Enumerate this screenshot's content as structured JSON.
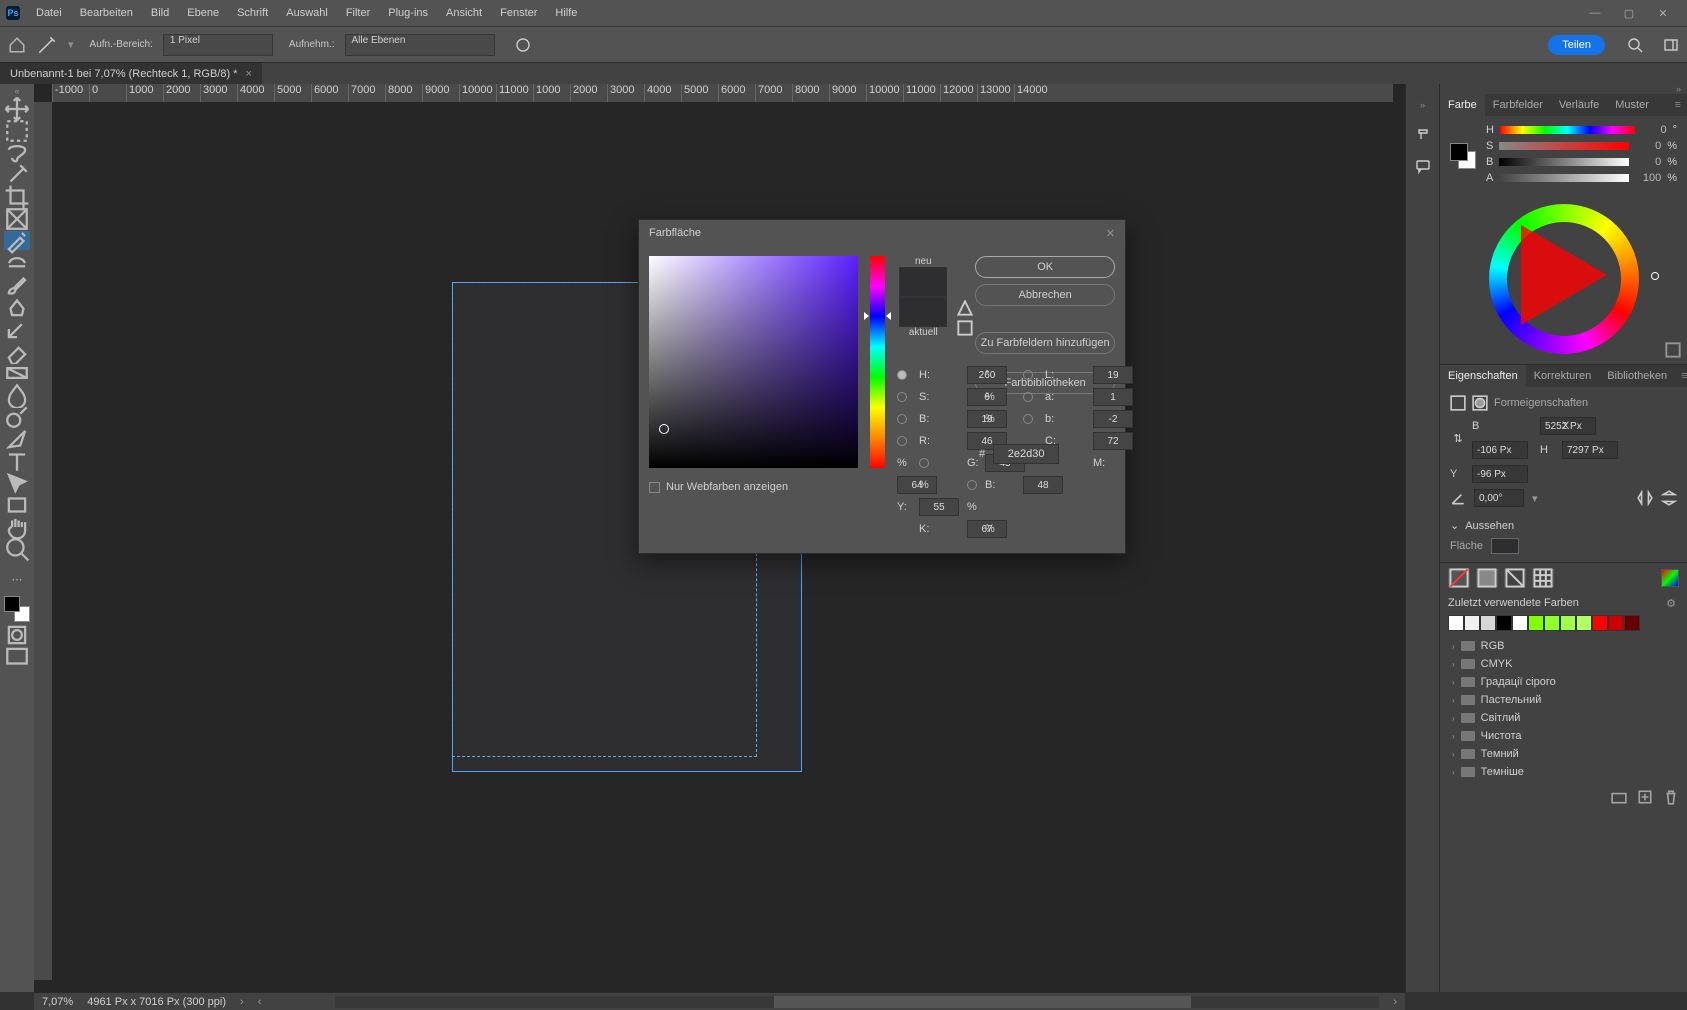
{
  "menubar": {
    "items": [
      "Datei",
      "Bearbeiten",
      "Bild",
      "Ebene",
      "Schrift",
      "Auswahl",
      "Filter",
      "Plug-ins",
      "Ansicht",
      "Fenster",
      "Hilfe"
    ]
  },
  "optbar": {
    "sample_label": "Aufn.-Bereich:",
    "sample_value": "1 Pixel",
    "sample2_label": "Aufnehm.:",
    "sample2_value": "Alle Ebenen",
    "share": "Teilen"
  },
  "tab": {
    "title": "Unbenannt-1 bei 7,07% (Rechteck 1, RGB/8) *"
  },
  "ruler_marks": [
    "-1000",
    "0",
    "1000",
    "2000",
    "3000",
    "4000",
    "5000",
    "6000",
    "7000",
    "8000",
    "9000",
    "10000",
    "11000",
    "1000",
    "2000",
    "3000",
    "4000",
    "5000",
    "6000",
    "7000",
    "8000",
    "9000",
    "10000",
    "11000",
    "12000",
    "13000",
    "14000"
  ],
  "picker": {
    "title": "Farbfläche",
    "neu": "neu",
    "aktuell": "aktuell",
    "ok": "OK",
    "cancel": "Abbrechen",
    "add": "Zu Farbfeldern hinzufügen",
    "libs": "Farbbibliotheken",
    "webonly": "Nur Webfarben anzeigen",
    "H": "260",
    "S": "6",
    "Bv": "19",
    "R": "46",
    "G": "45",
    "Bb": "48",
    "L": "19",
    "a": "1",
    "b": "-2",
    "C": "72",
    "M": "64",
    "Y": "55",
    "K": "67",
    "hex": "2e2d30",
    "deg": "°",
    "pct": "%",
    "lbl": {
      "H": "H:",
      "S": "S:",
      "B": "B:",
      "R": "R:",
      "G": "G:",
      "Bb": "B:",
      "L": "L:",
      "a": "a:",
      "b": "b:",
      "C": "C:",
      "M": "M:",
      "Y": "Y:",
      "K": "K:",
      "hash": "#"
    }
  },
  "panels": {
    "color_tabs": [
      "Farbe",
      "Farbfelder",
      "Verläufe",
      "Muster"
    ],
    "color_sliders": {
      "H": "0",
      "S": "0",
      "B": "0",
      "A": "100"
    },
    "props_tabs": [
      "Eigenschaften",
      "Korrekturen",
      "Bibliotheken"
    ],
    "props_title": "Formeigenschaften",
    "dims": {
      "B": "5252 Px",
      "H": "7297 Px",
      "X": "-106 Px",
      "Y": "-96 Px",
      "angle": "0,00°"
    },
    "appear_title": "Aussehen",
    "fill_lbl": "Fläche",
    "swatches_hdr": "Zuletzt verwendete Farben",
    "recent_colors": [
      "#ffffff",
      "#f0f0f0",
      "#d6d6d6",
      "#000000",
      "#ffffff",
      "#7fff00",
      "#8fff2e",
      "#9fff4c",
      "#afff66",
      "#ff0000",
      "#cc0000",
      "#660000"
    ],
    "folders": [
      "RGB",
      "CMYK",
      "Градації сірого",
      "Пастельний",
      "Світлий",
      "Чистота",
      "Темний",
      "Темніше"
    ]
  },
  "status": {
    "zoom": "7,07%",
    "docinfo": "4961 Px x 7016 Px (300 ppi)"
  }
}
